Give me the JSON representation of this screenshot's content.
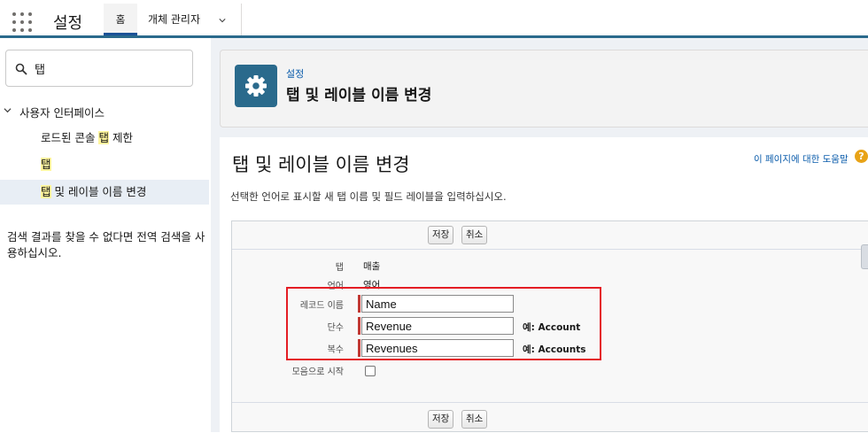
{
  "topbar": {
    "app_title": "설정",
    "tabs": [
      {
        "label": "홈"
      },
      {
        "label": "개체 관리자"
      }
    ]
  },
  "sidebar": {
    "quickfind_value": "탭",
    "tree_root": "사용자 인터페이스",
    "items": [
      {
        "before": "로드된 콘솔 ",
        "highlight": "탭",
        "after": " 제한"
      },
      {
        "before": "",
        "highlight": "탭",
        "after": ""
      },
      {
        "before": "",
        "highlight": "탭",
        "after": " 및 레이블 이름 변경"
      }
    ],
    "note": "검색 결과를 찾을 수 없다면 전역 검색을 사용하십시오."
  },
  "header": {
    "eyebrow": "설정",
    "title": "탭 및 레이블 이름 변경"
  },
  "content": {
    "page_title": "탭 및 레이블 이름 변경",
    "help_link": "이 페이지에 대한 도움말",
    "help_icon_glyph": "?",
    "instructions": "선택한 언어로 표시할 새 탭 이름 및 필드 레이블을 입력하십시오."
  },
  "buttons": {
    "save": "저장",
    "cancel": "취소"
  },
  "form": {
    "tab_label": "탭",
    "tab_value": "매출",
    "language_label": "언어",
    "language_value": "영어",
    "record_name_label": "레코드 이름",
    "record_name_value": "Name",
    "singular_label": "단수",
    "singular_value": "Revenue",
    "singular_example": "예: Account",
    "plural_label": "복수",
    "plural_value": "Revenues",
    "plural_example": "예: Accounts",
    "starts_with_vowel_label": "모음으로 시작",
    "starts_with_vowel_checked": false
  },
  "colors": {
    "brand": "#2a6a8c",
    "link": "#0b5cab",
    "required": "#c23934",
    "annotation_box": "#e41d24",
    "highlight": "#fff59d"
  },
  "icons": {
    "app_launcher": "app-launcher-icon",
    "search": "search-icon",
    "gear": "gear-icon",
    "help": "help-icon",
    "chevron": "chevron-down-icon"
  }
}
